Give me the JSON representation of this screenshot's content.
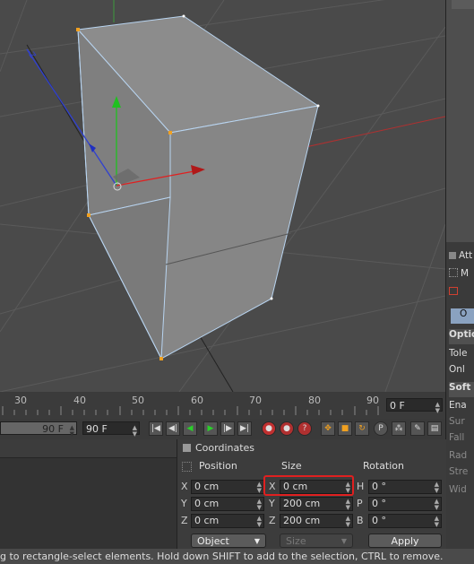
{
  "viewport": {
    "description_hidden": true
  },
  "right_panel": {
    "attributes_tab": "Att",
    "mode_tab": "M",
    "object_button": "O",
    "options_header": "Optio",
    "tolerance_label": "Tole",
    "only_visible_label": "Onl",
    "soft_selection_header": "Soft",
    "enable_label": "Ena",
    "surface_label": "Sur",
    "falloff_label": "Fall",
    "radius_label": "Rad",
    "strength_label": "Stre",
    "width_label": "Wid"
  },
  "timeline": {
    "ticks": [
      "30",
      "40",
      "50",
      "60",
      "70",
      "80",
      "90"
    ],
    "current_frame": "0 F"
  },
  "transport": {
    "end_frame_left": "90 F",
    "end_frame_right": "90 F"
  },
  "coordinates": {
    "title": "Coordinates",
    "col_position": "Position",
    "col_size": "Size",
    "col_rotation": "Rotation",
    "rows": [
      {
        "axis": "X",
        "position": "0 cm",
        "size_axis": "X",
        "size": "0 cm",
        "rot_axis": "H",
        "rotation": "0 °"
      },
      {
        "axis": "Y",
        "position": "0 cm",
        "size_axis": "Y",
        "size": "200 cm",
        "rot_axis": "P",
        "rotation": "0 °"
      },
      {
        "axis": "Z",
        "position": "0 cm",
        "size_axis": "Z",
        "size": "200 cm",
        "rot_axis": "B",
        "rotation": "0 °"
      }
    ],
    "mode_dropdown": "Object",
    "size_dropdown": "Size",
    "apply_button": "Apply",
    "highlight_color": "#e02020"
  },
  "status_bar": {
    "text": "g to rectangle-select elements. Hold down SHIFT to add to the selection, CTRL to remove."
  }
}
